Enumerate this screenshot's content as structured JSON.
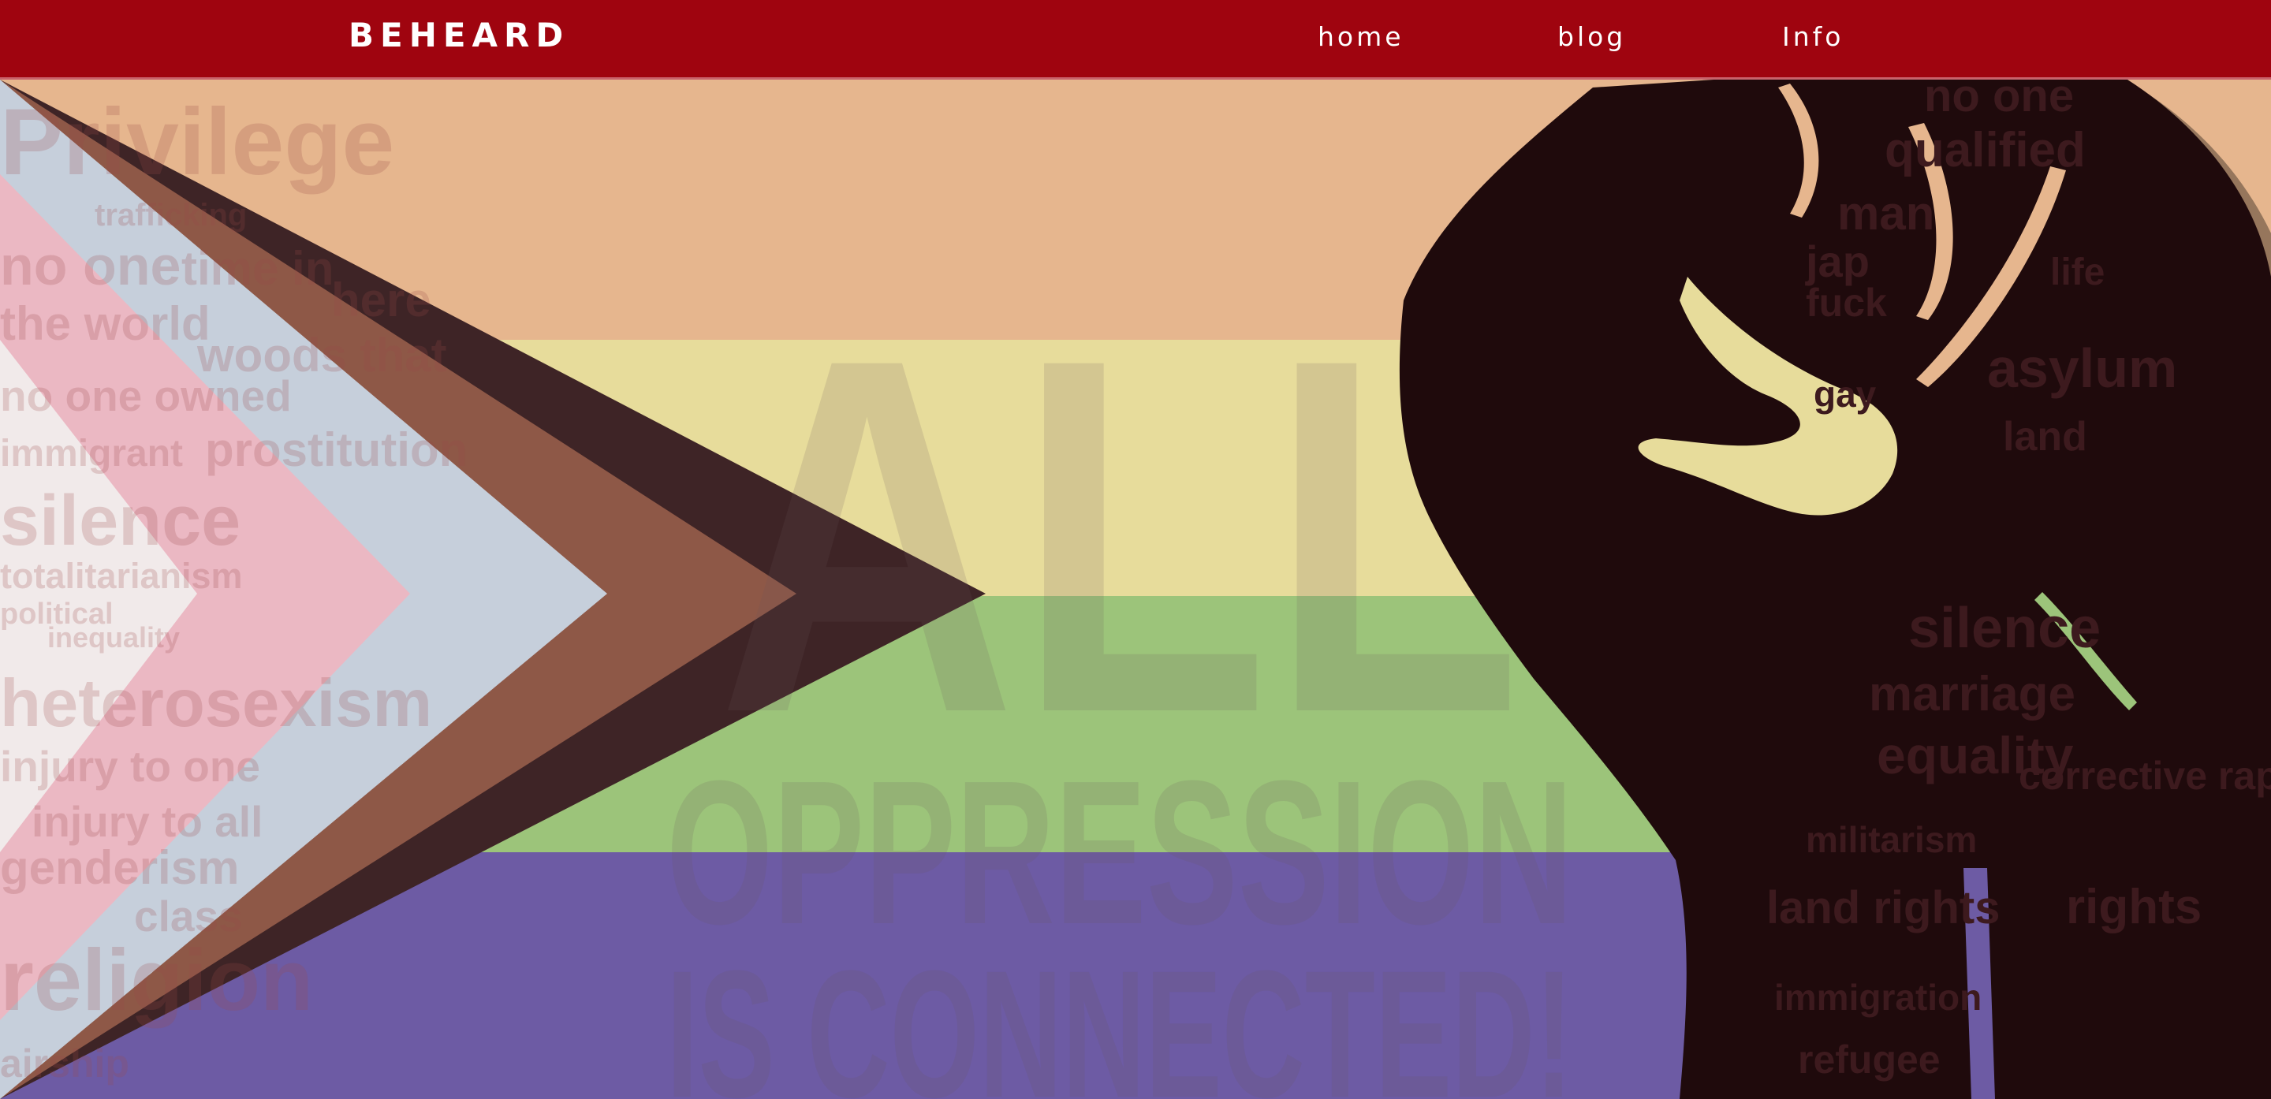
{
  "navbar": {
    "brand": "BEHEARD",
    "links": [
      {
        "label": "home"
      },
      {
        "label": "blog"
      },
      {
        "label": "Info"
      }
    ],
    "background_color": "#9f040f"
  },
  "hero": {
    "poster_line_1": "ALL",
    "poster_line_2": "OPPRESSION",
    "poster_line_3": "IS CONNECTED!",
    "background_words": [
      "Privilege",
      "trafficking",
      "no one",
      "time in",
      "the world",
      "here",
      "woods that",
      "no one owned",
      "immigrant",
      "prostitution",
      "silence",
      "totalitarianism",
      "political",
      "inequality",
      "heterosexism",
      "injury to one",
      "injury to all",
      "genderism",
      "class",
      "religion",
      "airship"
    ],
    "fist_words": [
      "qualified",
      "no one",
      "man",
      "jap",
      "fuck",
      "life",
      "asylum",
      "land",
      "gay",
      "silence",
      "marriage",
      "equality",
      "corrective rape",
      "militarism",
      "land rights",
      "rights",
      "immigration",
      "refugee"
    ],
    "stripe_colors": [
      "#e6b68e",
      "#e7dc9b",
      "#9cc47a",
      "#6d5ba4"
    ],
    "chevron_colors": [
      "#ebb8c3",
      "#c6cfdb",
      "#8e5847",
      "#3e2426"
    ],
    "fist_color": "#1f0a0c"
  }
}
